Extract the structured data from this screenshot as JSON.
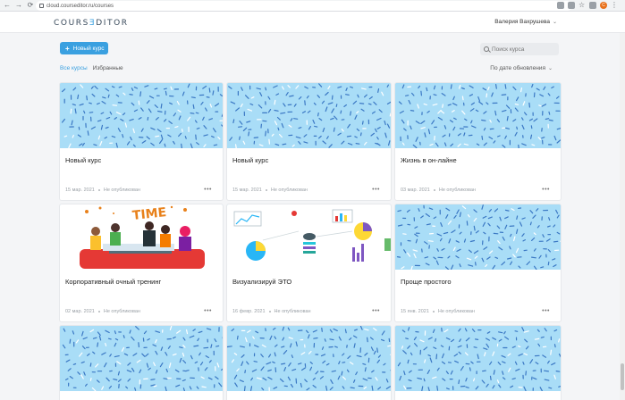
{
  "browser": {
    "url": "cloud.courseditor.ru/courses",
    "back": "←",
    "forward": "→",
    "reload": "⟳",
    "avatar_letter": "C"
  },
  "header": {
    "logo_part1": "COURS",
    "logo_part2": "Ǝ",
    "logo_part3": "DITOR",
    "user_name": "Валерия Вахрушева"
  },
  "toolbar": {
    "new_course": "Новый курс",
    "search_placeholder": "Поиск курса"
  },
  "tabs": [
    {
      "label": "Все курсы",
      "active": true
    },
    {
      "label": "Избранные",
      "active": false
    }
  ],
  "sort_label": "По дате обновления",
  "courses": [
    {
      "title": "Новый курс",
      "date": "15 мар. 2021",
      "status": "Не опубликован",
      "cover": "pattern"
    },
    {
      "title": "Новый курс",
      "date": "15 мар. 2021",
      "status": "Не опубликован",
      "cover": "pattern"
    },
    {
      "title": "Жизнь в он-лайне",
      "date": "03 мар. 2021",
      "status": "Не опубликован",
      "cover": "pattern"
    },
    {
      "title": "Корпоративный очный тренинг",
      "date": "02 мар. 2021",
      "status": "Не опубликован",
      "cover": "party"
    },
    {
      "title": "Визуализируй ЭТО",
      "date": "16 февр. 2021",
      "status": "Не опубликован",
      "cover": "charts"
    },
    {
      "title": "Проще простого",
      "date": "15 янв. 2021",
      "status": "Не опубликован",
      "cover": "pattern"
    },
    {
      "title": "",
      "date": "",
      "status": "",
      "cover": "pattern"
    },
    {
      "title": "",
      "date": "",
      "status": "",
      "cover": "pattern"
    },
    {
      "title": "",
      "date": "",
      "status": "",
      "cover": "pattern"
    }
  ],
  "illustration_text": "TIME",
  "colors": {
    "accent": "#3aa0e0",
    "cover_bg": "#a9ddf7",
    "pattern_stroke": "#3b78c4"
  }
}
